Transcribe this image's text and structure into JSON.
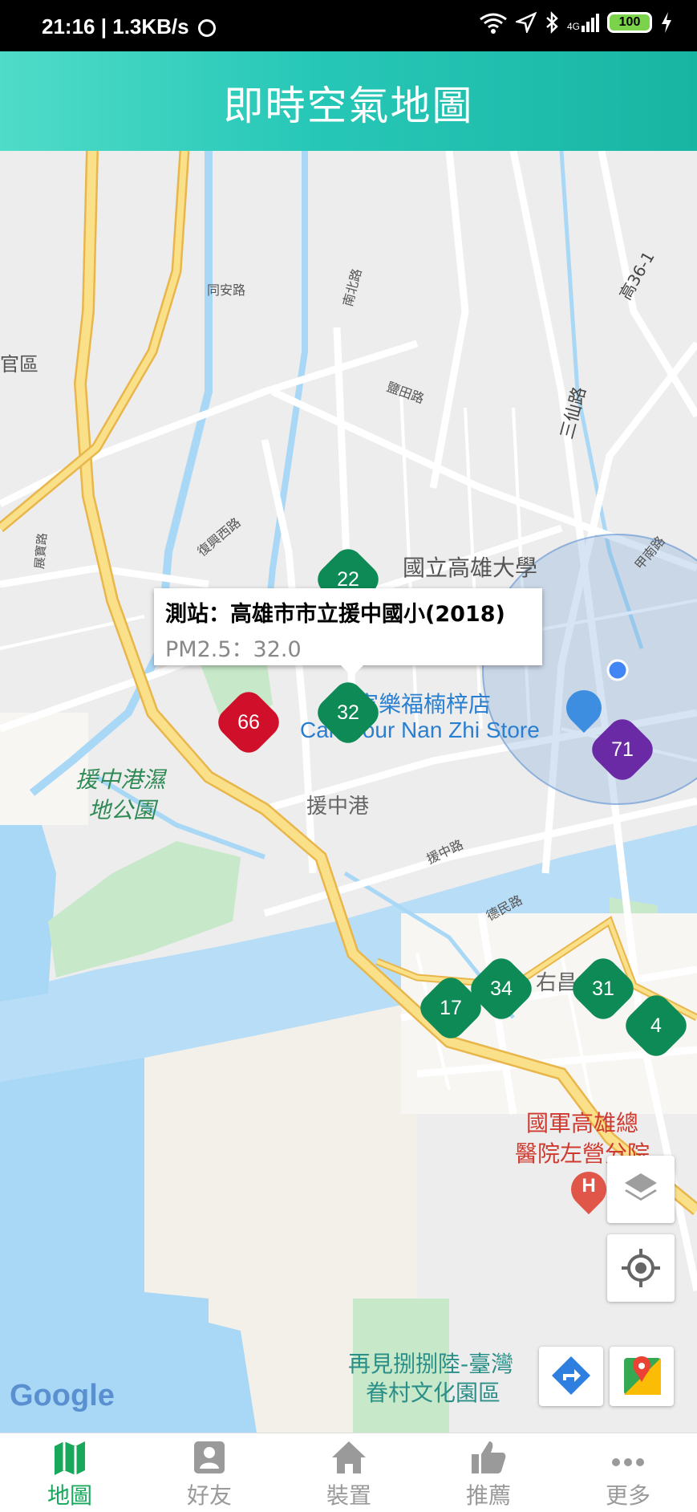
{
  "status_bar": {
    "time": "21:16",
    "speed": "1.3KB/s",
    "network": "4G",
    "battery": "100"
  },
  "header": {
    "title": "即時空氣地圖"
  },
  "map": {
    "info_window": {
      "station": "測站：高雄市市立援中國小(2018)",
      "reading": "PM2.5：32.0"
    },
    "markers": [
      {
        "value": "22",
        "color": "#0d8a55"
      },
      {
        "value": "32",
        "color": "#0d8a55"
      },
      {
        "value": "66",
        "color": "#d0102a"
      },
      {
        "value": "71",
        "color": "#6a2aa6"
      },
      {
        "value": "17",
        "color": "#0d8a55"
      },
      {
        "value": "34",
        "color": "#0d8a55"
      },
      {
        "value": "31",
        "color": "#0d8a55"
      },
      {
        "value": "4",
        "color": "#0d8a55"
      }
    ],
    "labels": {
      "tongan": "同安路",
      "nanbei": "南北路",
      "yantian": "鹽田路",
      "sanxian": "三仙路",
      "gao36": "高36-1",
      "guan": "官區",
      "zhanbao": "展寶路",
      "fuxingxi": "復興西路",
      "nuk": "國立高雄大學",
      "jiajia": "甲南路",
      "carrefour_zh": "家樂福楠梓店",
      "carrefour_en": "Carrefour Nan Zhi Store",
      "wetland1": "援中港濕",
      "wetland2": "地公園",
      "yuanzhonggang": "援中港",
      "yuanzhong_rd": "援中路",
      "demin": "德民路",
      "youchang": "右昌",
      "hospital1": "國軍高雄總",
      "hospital2": "醫院左營分院",
      "village1": "再見捌捌陸-臺灣",
      "village2": "眷村文化園區",
      "google": "Google"
    }
  },
  "tabs": [
    {
      "label": "地圖",
      "icon": "map-icon"
    },
    {
      "label": "好友",
      "icon": "friend-icon"
    },
    {
      "label": "裝置",
      "icon": "home-icon"
    },
    {
      "label": "推薦",
      "icon": "thumbs-up-icon"
    },
    {
      "label": "更多",
      "icon": "more-icon"
    }
  ],
  "colors": {
    "header_start": "#4fdcc8",
    "header_end": "#19b5a3",
    "good": "#0d8a55",
    "unhealthy": "#d0102a",
    "very_unhealthy": "#6a2aa6",
    "tab_active": "#17a85c"
  }
}
